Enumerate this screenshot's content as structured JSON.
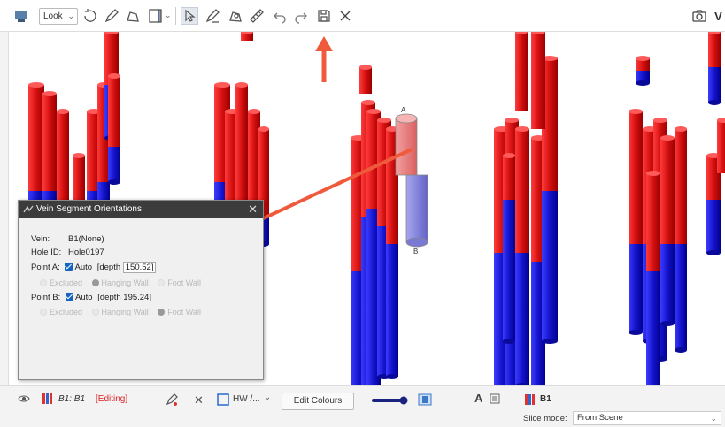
{
  "toolbar": {
    "look_label": "Look",
    "icons": [
      "layer-icon",
      "rotate-icon",
      "pencil-icon",
      "polyline-icon",
      "slice-icon",
      "select-icon",
      "draw-icon",
      "edit-icon",
      "measure-icon",
      "undo-icon",
      "redo-icon",
      "save-icon",
      "close-icon",
      "camera-icon"
    ]
  },
  "dialog": {
    "title": "Vein Segment Orientations",
    "vein_label": "Vein:",
    "vein_value": "B1(None)",
    "hole_label": "Hole ID:",
    "hole_value": "Hole0197",
    "point_a_label": "Point A:",
    "point_a_auto": "Auto",
    "point_a_depth_prefix": "[depth",
    "point_a_depth": "150.52]",
    "point_a_radios": [
      "Excluded",
      "Hanging Wall",
      "Foot Wall"
    ],
    "point_b_label": "Point B:",
    "point_b_auto": "Auto",
    "point_b_depth": "[depth  195.24]",
    "point_b_radios": [
      "Excluded",
      "Hanging Wall",
      "Foot Wall"
    ]
  },
  "scene": {
    "marker_a": "A",
    "marker_b": "B",
    "colors": {
      "hanging": "#e01b1b",
      "foot": "#1a1ad6",
      "selected_top": "#e87b7b",
      "selected_bottom": "#8282e0",
      "arrow": "#f05a3c"
    }
  },
  "bottombar": {
    "layer_name": "B1: B1",
    "editing": "[Editing]",
    "hw_label": "HW /...",
    "edit_colours": "Edit Colours"
  },
  "rightpanel": {
    "title": "B1",
    "slice_label": "Slice mode:",
    "slice_value": "From Scene"
  }
}
